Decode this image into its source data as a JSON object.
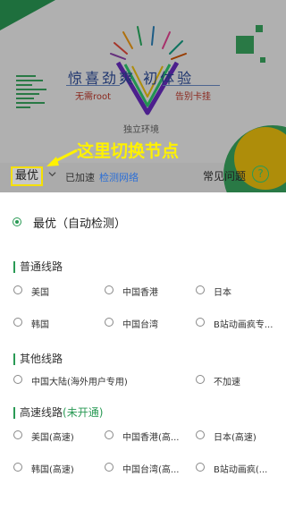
{
  "banner": {
    "headline": "惊喜劲爽  初体验",
    "sub_left": "无需root",
    "sub_right": "告别卡挂",
    "env": "独立环境"
  },
  "nodebar": {
    "current": "最优",
    "accel_label": "已加速",
    "detect_label": "检测网络",
    "faq_label": "常见问题",
    "help_symbol": "?"
  },
  "annotation": "这里切换节点",
  "panel": {
    "best_label": "最优（自动检测）",
    "sections": [
      {
        "title": "普通线路",
        "title_suffix": "",
        "options": [
          "美国",
          "中国香港",
          "日本",
          "韩国",
          "中国台湾",
          "B站动画疯专..."
        ]
      },
      {
        "title": "其他线路",
        "title_suffix": "",
        "options": [
          "中国大陆(海外用户专用)",
          "不加速"
        ]
      },
      {
        "title": "高速线路",
        "title_suffix": "(未开通)",
        "options": [
          "美国(高速)",
          "中国香港(高...",
          "日本(高速)",
          "韩国(高速)",
          "中国台湾(高...",
          "B站动画疯(..."
        ]
      }
    ]
  },
  "colors": {
    "accent": "#2a9a55",
    "link": "#2c6fd6",
    "annotation": "#fff200"
  }
}
